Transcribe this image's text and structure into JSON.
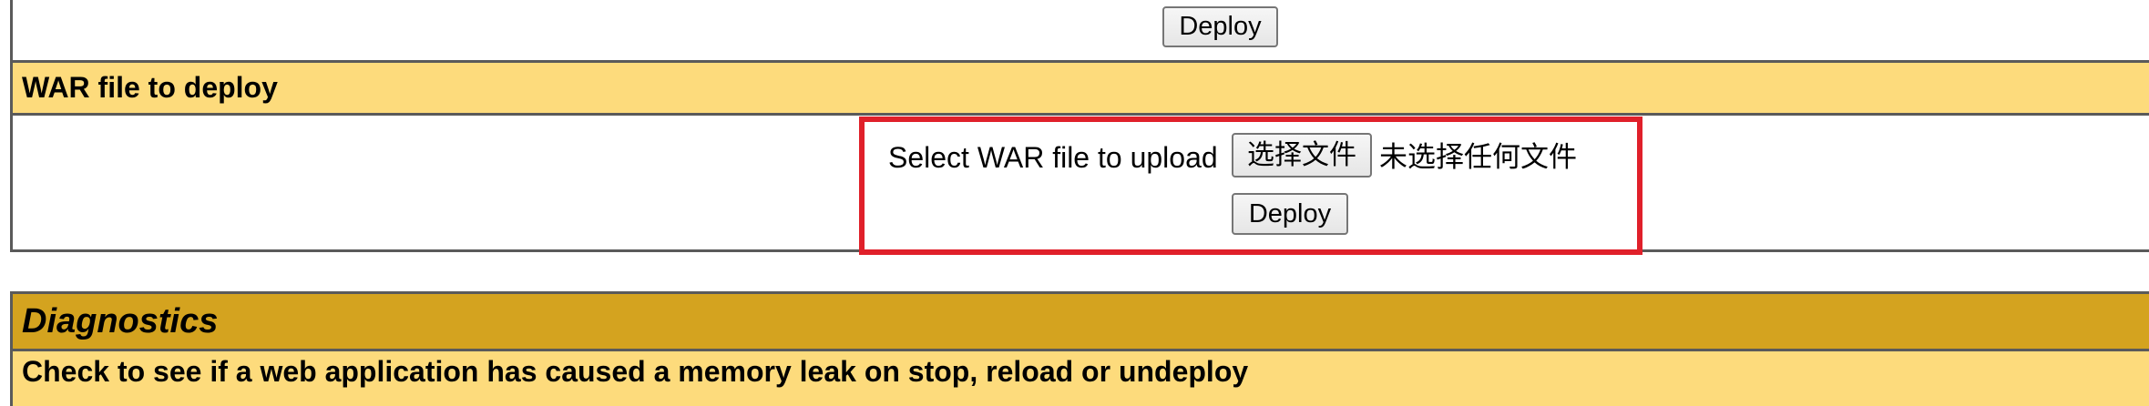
{
  "top_section": {
    "deploy_label": "Deploy"
  },
  "war_section": {
    "header": "WAR file to deploy",
    "upload_label": "Select WAR file to upload",
    "choose_file_label": "选择文件",
    "no_file_text": "未选择任何文件",
    "deploy_label": "Deploy"
  },
  "diagnostics": {
    "title": "Diagnostics",
    "subtitle": "Check to see if a web application has caused a memory leak on stop, reload or undeploy"
  },
  "colors": {
    "section_header": "#fddb7c",
    "diagnostics_header": "#d4a31f",
    "highlight": "#e0202a",
    "border": "#5a5a5a"
  }
}
